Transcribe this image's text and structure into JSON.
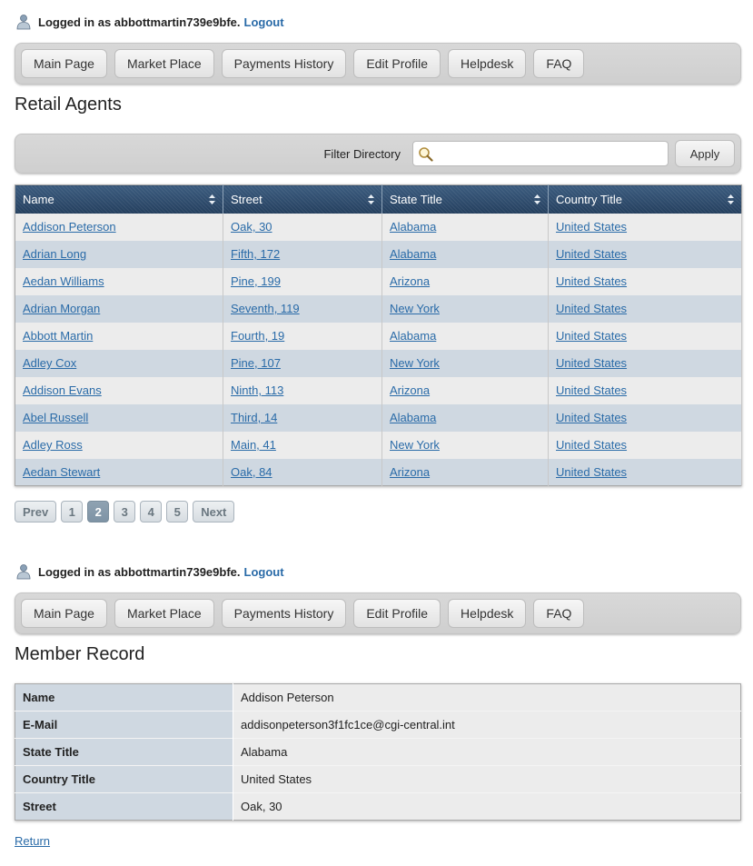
{
  "session": {
    "prefix": "Logged in as",
    "username": "abbottmartin739e9bfe.",
    "logout_label": "Logout"
  },
  "nav": {
    "items": [
      {
        "label": "Main Page"
      },
      {
        "label": "Market Place"
      },
      {
        "label": "Payments History"
      },
      {
        "label": "Edit Profile"
      },
      {
        "label": "Helpdesk"
      },
      {
        "label": "FAQ"
      }
    ]
  },
  "directory": {
    "title": "Retail Agents",
    "filter_label": "Filter Directory",
    "filter_value": "",
    "apply_label": "Apply",
    "columns": [
      "Name",
      "Street",
      "State Title",
      "Country Title"
    ],
    "rows": [
      {
        "name": "Addison Peterson",
        "street": "Oak, 30",
        "state": "Alabama",
        "country": "United States"
      },
      {
        "name": "Adrian Long",
        "street": "Fifth, 172",
        "state": "Alabama",
        "country": "United States"
      },
      {
        "name": "Aedan Williams",
        "street": "Pine, 199",
        "state": "Arizona",
        "country": "United States"
      },
      {
        "name": "Adrian Morgan",
        "street": "Seventh, 119",
        "state": "New York",
        "country": "United States"
      },
      {
        "name": "Abbott Martin",
        "street": "Fourth, 19",
        "state": "Alabama",
        "country": "United States"
      },
      {
        "name": "Adley Cox",
        "street": "Pine, 107",
        "state": "New York",
        "country": "United States"
      },
      {
        "name": "Addison Evans",
        "street": "Ninth, 113",
        "state": "Arizona",
        "country": "United States"
      },
      {
        "name": "Abel Russell",
        "street": "Third, 14",
        "state": "Alabama",
        "country": "United States"
      },
      {
        "name": "Adley Ross",
        "street": "Main, 41",
        "state": "New York",
        "country": "United States"
      },
      {
        "name": "Aedan Stewart",
        "street": "Oak, 84",
        "state": "Arizona",
        "country": "United States"
      }
    ]
  },
  "pager": {
    "prev_label": "Prev",
    "next_label": "Next",
    "pages": [
      "1",
      "2",
      "3",
      "4",
      "5"
    ],
    "current": "2"
  },
  "record": {
    "title": "Member Record",
    "fields": [
      {
        "label": "Name",
        "value": "Addison Peterson"
      },
      {
        "label": "E-Mail",
        "value": "addisonpeterson3f1fc1ce@cgi-central.int"
      },
      {
        "label": "State Title",
        "value": "Alabama"
      },
      {
        "label": "Country Title",
        "value": "United States"
      },
      {
        "label": "Street",
        "value": "Oak, 30"
      }
    ],
    "return_label": "Return"
  },
  "colors": {
    "link": "#2a6ba8",
    "header_bg": "#2c4a6b",
    "row_alt": "#cfd8e1",
    "row_base": "#ececec"
  },
  "icons": [
    "user-icon",
    "search-icon",
    "sort-icon"
  ]
}
